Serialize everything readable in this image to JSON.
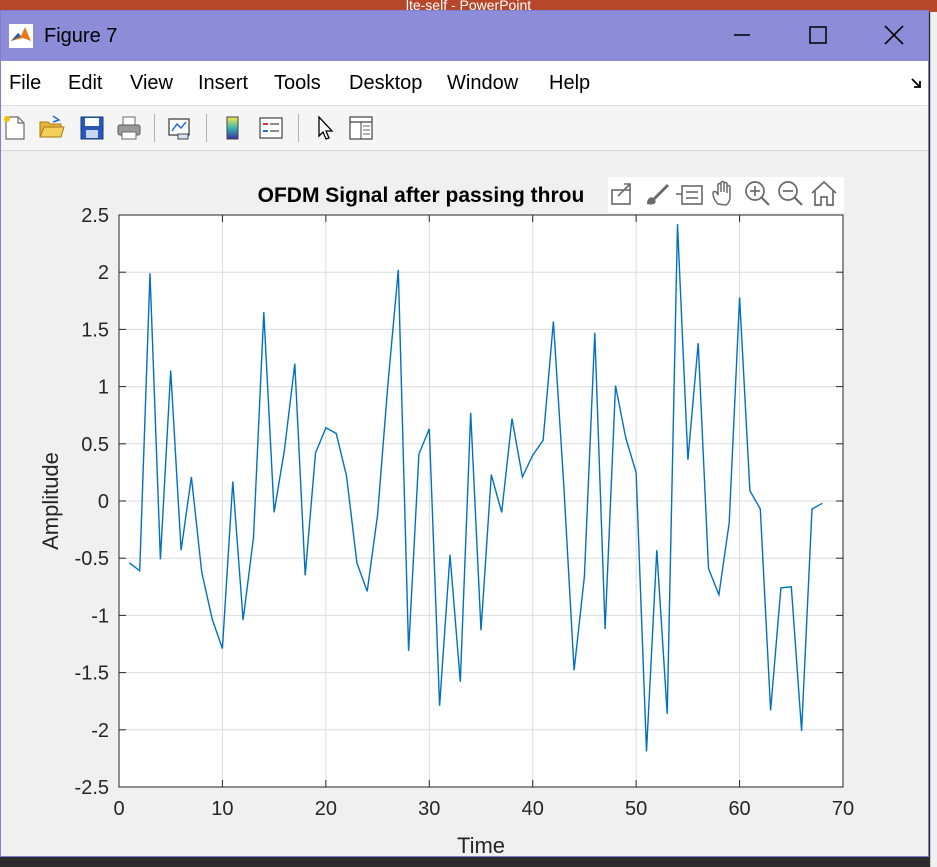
{
  "background_app": {
    "title": "lte-self - PowerPoint"
  },
  "window": {
    "title": "Figure 7",
    "app_icon": "matlab-icon",
    "controls": [
      "minimize-icon",
      "maximize-icon",
      "close-icon"
    ]
  },
  "menu": {
    "items": [
      "File",
      "Edit",
      "View",
      "Insert",
      "Tools",
      "Desktop",
      "Window",
      "Help"
    ],
    "dock_icon": "dock-arrow-icon"
  },
  "toolbar": {
    "icons": [
      "new-figure-icon",
      "open-file-icon",
      "save-icon",
      "print-icon",
      "link-plot-icon",
      "colorbar-icon",
      "legend-icon",
      "edit-plot-icon",
      "property-inspector-icon"
    ]
  },
  "axes_toolbar": {
    "icons": [
      "export-icon",
      "brush-icon",
      "data-tips-icon",
      "pan-icon",
      "zoom-in-icon",
      "zoom-out-icon",
      "home-icon"
    ]
  },
  "colors": {
    "titlebar": "#8c8cd9",
    "line": "#0072bd",
    "grid": "#dcdcdc",
    "axes_bg": "#ffffff",
    "figure_bg": "#f0f0f0"
  },
  "chart_data": {
    "type": "line",
    "title": "OFDM Signal after passing throu",
    "xlabel": "Time",
    "ylabel": "Amplitude",
    "xlim": [
      0,
      70
    ],
    "ylim": [
      -2.5,
      2.5
    ],
    "xticks": [
      "0",
      "10",
      "20",
      "30",
      "40",
      "50",
      "60",
      "70"
    ],
    "yticks": [
      "2.5",
      "2",
      "1.5",
      "1",
      "0.5",
      "0",
      "-0.5",
      "-1",
      "-1.5",
      "-2",
      "-2.5"
    ],
    "grid": true,
    "series": [
      {
        "color": "#0072bd",
        "x": [
          1,
          2,
          3,
          4,
          5,
          6,
          7,
          8,
          9,
          10,
          11,
          12,
          13,
          14,
          15,
          16,
          17,
          18,
          19,
          20,
          21,
          22,
          23,
          24,
          25,
          26,
          27,
          28,
          29,
          30,
          31,
          32,
          33,
          34,
          35,
          36,
          37,
          38,
          39,
          40,
          41,
          42,
          43,
          44,
          45,
          46,
          47,
          48,
          49,
          50,
          51,
          52,
          53,
          54,
          55,
          56,
          57,
          58,
          59,
          60,
          61,
          62,
          63,
          64,
          65,
          66,
          67,
          68
        ],
        "y": [
          -0.54,
          -0.61,
          1.99,
          -0.51,
          1.14,
          -0.43,
          0.21,
          -0.62,
          -1.03,
          -1.29,
          0.17,
          -1.04,
          -0.32,
          1.65,
          -0.1,
          0.45,
          1.2,
          -0.65,
          0.42,
          0.64,
          0.59,
          0.22,
          -0.54,
          -0.79,
          -0.12,
          1.02,
          2.02,
          -1.31,
          0.41,
          0.63,
          -1.79,
          -0.47,
          -1.58,
          0.77,
          -1.13,
          0.23,
          -0.1,
          0.72,
          0.21,
          0.4,
          0.53,
          1.57,
          0.15,
          -1.48,
          -0.66,
          1.47,
          -1.12,
          1.01,
          0.55,
          0.25,
          -2.19,
          -0.43,
          -1.86,
          2.42,
          0.36,
          1.38,
          -0.59,
          -0.82,
          -0.19,
          1.78,
          0.09,
          -0.07,
          -1.83,
          -0.76,
          -0.75,
          -2.01,
          -0.07,
          -0.02
        ]
      }
    ]
  }
}
